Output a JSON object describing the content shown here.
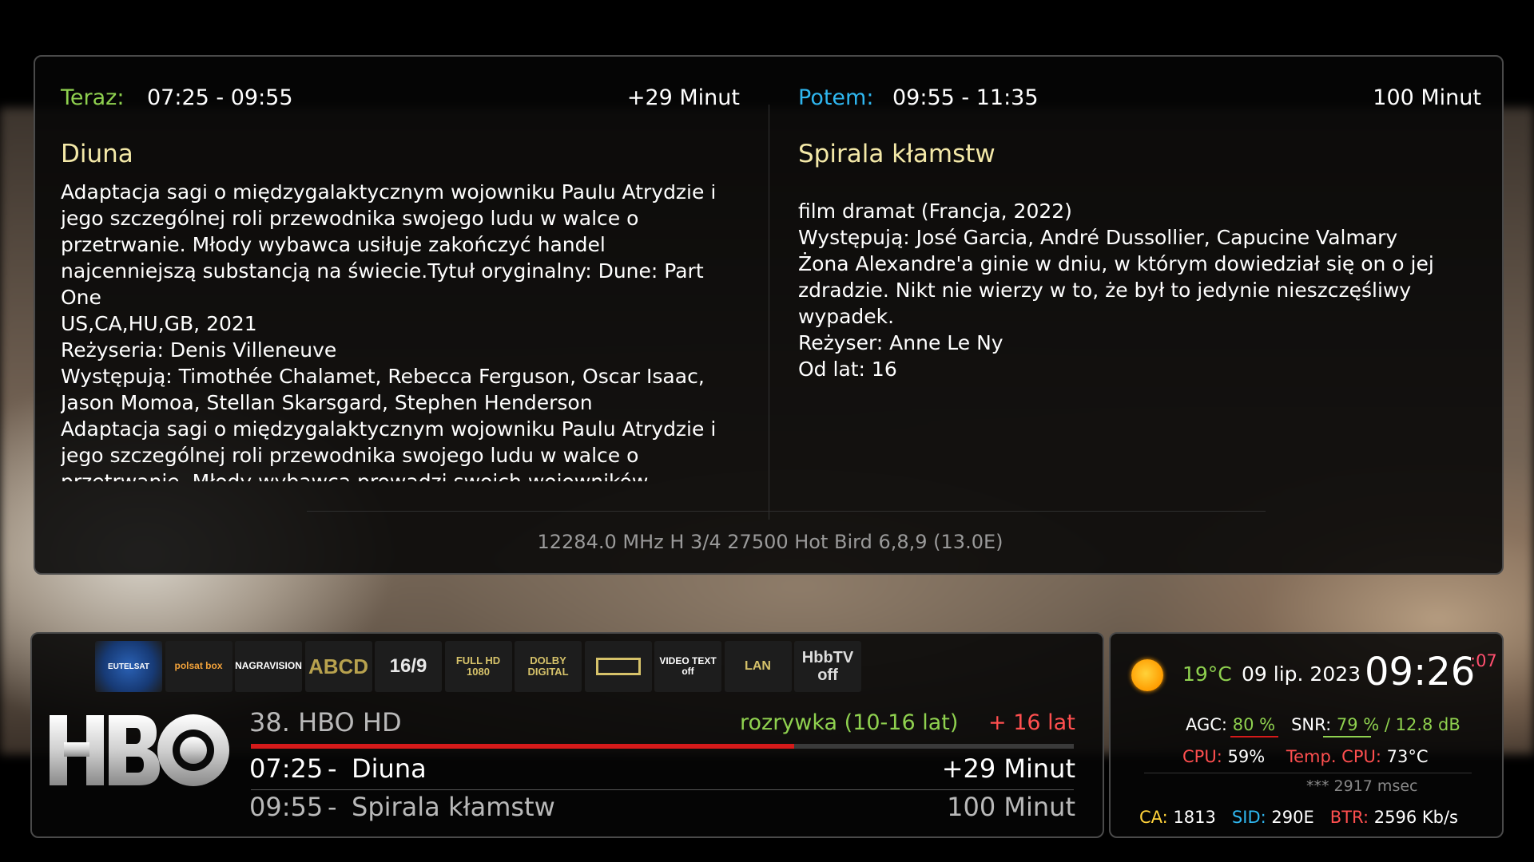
{
  "now": {
    "label": "Teraz:",
    "time": "07:25 - 09:55",
    "remaining": "+29 Minut",
    "title": "Diuna",
    "description_lines": [
      "Adaptacja sagi o międzygalaktycznym wojowniku Paulu Atrydzie i",
      "jego szczególnej roli przewodnika swojego ludu w walce o",
      "przetrwanie. Młody wybawca usiłuje zakończyć handel",
      "najcenniejszą substancją na świecie.Tytuł oryginalny: Dune: Part",
      "One",
      "US,CA,HU,GB, 2021",
      "Reżyseria: Denis Villeneuve",
      "Występują: Timothée Chalamet, Rebecca Ferguson, Oscar Isaac,",
      "Jason Momoa, Stellan Skarsgard, Stephen Henderson",
      "Adaptacja sagi o międzygalaktycznym wojowniku Paulu Atrydzie i",
      "jego szczególnej roli przewodnika swojego ludu w walce o",
      "przetrwanie. Młody wybawca prowadzi swoich wojowników"
    ]
  },
  "next": {
    "label": "Potem:",
    "time": "09:55 - 11:35",
    "duration": "100 Minut",
    "title": "Spirala kłamstw",
    "description_lines": [
      "film dramat (Francja, 2022)",
      "Występują: José Garcia, André Dussollier, Capucine Valmary",
      "Żona Alexandre'a ginie w dniu, w którym dowiedział się on o jej",
      "zdradzie. Nikt nie wierzy w to, że był to jedynie nieszczęśliwy",
      "wypadek.",
      "Reżyser: Anne Le Ny",
      "Od lat: 16"
    ]
  },
  "transponder": "12284.0 MHz  H  3/4  27500  Hot Bird 6,8,9 (13.0E)",
  "icons": [
    {
      "name": "eutelsat-hotbird-icon",
      "text": "EUTELSAT"
    },
    {
      "name": "polsat-box-icon",
      "text": "polsat box"
    },
    {
      "name": "nagravision-icon",
      "text": "NAGRAVISION"
    },
    {
      "name": "abcd-icon",
      "text": "ABCD"
    },
    {
      "name": "aspect-16-9-icon",
      "text": "16/9"
    },
    {
      "name": "full-hd-1080-icon",
      "text": "FULL HD 1080"
    },
    {
      "name": "dolby-digital-icon",
      "text": "DOLBY DIGITAL"
    },
    {
      "name": "widescreen-icon",
      "text": ""
    },
    {
      "name": "video-text-off-icon",
      "text": "VIDEO TEXT off"
    },
    {
      "name": "lan-icon",
      "text": "LAN"
    },
    {
      "name": "hbbtv-off-icon",
      "text": "HbbTV off"
    }
  ],
  "channel": {
    "logo_text": "HBO",
    "name": "38. HBO HD",
    "genre": "rozrywka (10-16 lat)",
    "age": "+ 16 lat",
    "progress_fraction": 0.66,
    "current": {
      "start": "07:25",
      "sep": "-",
      "title": "Diuna",
      "remaining": "+29 Minut"
    },
    "following": {
      "start": "09:55",
      "sep": "-",
      "title": "Spirala kłamstw",
      "duration": "100 Minut"
    }
  },
  "system": {
    "temperature": "19°C",
    "date": "09 lip. 2023",
    "clock": "09:26",
    "seconds": ":07",
    "agc_label": "AGC:",
    "agc_value": "80 %",
    "snr_label": "SNR:",
    "snr_value": "79 % / 12.8 dB",
    "cpu_label": "CPU:",
    "cpu_value": "59%",
    "tempcpu_label": "Temp. CPU:",
    "tempcpu_value": "73°C",
    "ecm_time": "*** 2917 msec",
    "ca_label": "CA:",
    "ca_value": "1813",
    "sid_label": "SID:",
    "sid_value": "290E",
    "btr_label": "BTR:",
    "btr_value": "2596 Kb/s"
  },
  "colors": {
    "accent_green": "#8fd14f",
    "accent_blue": "#2fb7f0",
    "accent_red": "#d51a1a",
    "title_yellow": "#f4e9a8"
  }
}
